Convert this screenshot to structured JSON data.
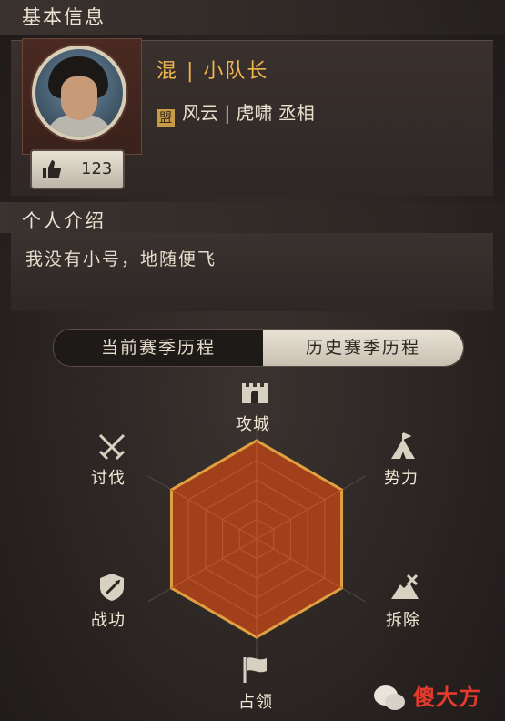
{
  "basic_info": {
    "header": "基本信息"
  },
  "profile": {
    "name_line": "混 | 小队长",
    "alliance_icon": "盟",
    "alliance_line": "风云 | 虎啸 丞相",
    "likes": "123"
  },
  "intro": {
    "header": "个人介绍",
    "text": "我没有小号，地随便飞"
  },
  "tabs": [
    {
      "label": "当前赛季历程",
      "active": false
    },
    {
      "label": "历史赛季历程",
      "active": true
    }
  ],
  "radar": {
    "axes": [
      {
        "label": "攻城",
        "icon": "castle-gate-icon"
      },
      {
        "label": "势力",
        "icon": "camp-tent-icon"
      },
      {
        "label": "拆除",
        "icon": "demolish-icon"
      },
      {
        "label": "占领",
        "icon": "flag-icon"
      },
      {
        "label": "战功",
        "icon": "shield-sword-icon"
      },
      {
        "label": "讨伐",
        "icon": "crossed-swords-icon"
      }
    ],
    "colors": {
      "fill": "#a3401c",
      "edge": "#e0a040",
      "web": "#b8552c"
    }
  },
  "watermark": {
    "text": "傻大方"
  }
}
